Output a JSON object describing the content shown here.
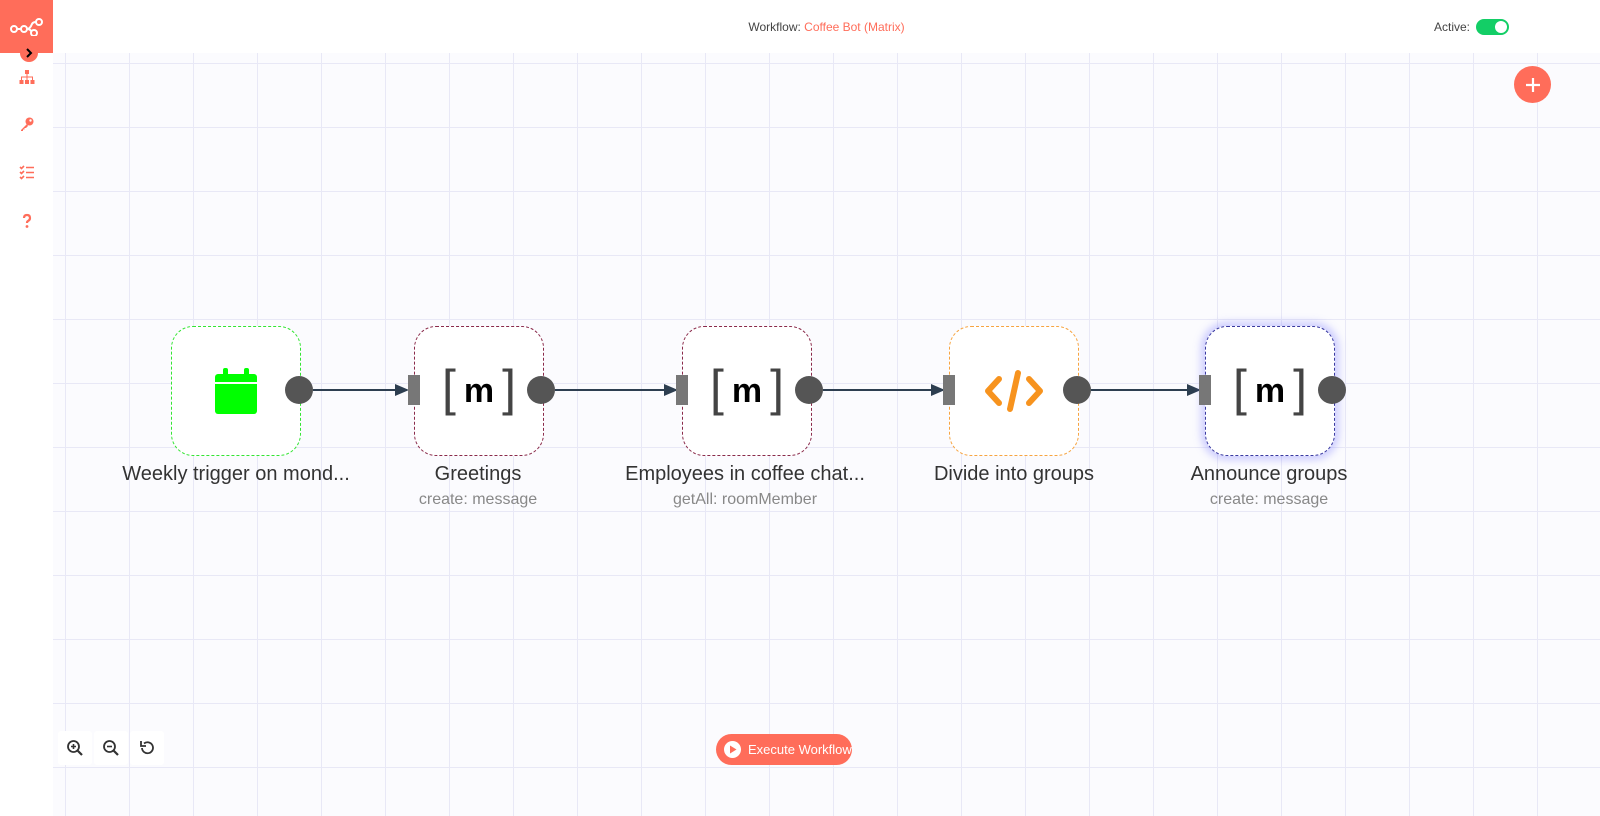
{
  "header": {
    "workflow_prefix": "Workflow:",
    "workflow_name": "Coffee Bot (Matrix)",
    "active_label": "Active:",
    "active": true
  },
  "sidebar": {
    "items": [
      {
        "name": "workflows",
        "icon": "sitemap-icon"
      },
      {
        "name": "credentials",
        "icon": "key-icon"
      },
      {
        "name": "executions",
        "icon": "tasks-icon"
      },
      {
        "name": "help",
        "icon": "question-icon"
      }
    ]
  },
  "nodes": [
    {
      "label": "Weekly trigger on mond...",
      "subtitle": "",
      "icon": "calendar-icon"
    },
    {
      "label": "Greetings",
      "subtitle": "create: message",
      "icon": "matrix-icon"
    },
    {
      "label": "Employees in coffee chat...",
      "subtitle": "getAll: roomMember",
      "icon": "matrix-icon"
    },
    {
      "label": "Divide into groups",
      "subtitle": "",
      "icon": "code-icon"
    },
    {
      "label": "Announce groups",
      "subtitle": "create: message",
      "icon": "matrix-icon"
    }
  ],
  "matrix_logo": {
    "left": "[",
    "letter": "m",
    "right": "]"
  },
  "execute": {
    "label": "Execute Workflow"
  },
  "colors": {
    "accent": "#ff6d5a",
    "toggle_on": "#13ce66",
    "trigger_border": "#33e533",
    "code_border": "#f7a440",
    "matrix_border": "#8a2a4a",
    "connection": "#2d3e50"
  }
}
